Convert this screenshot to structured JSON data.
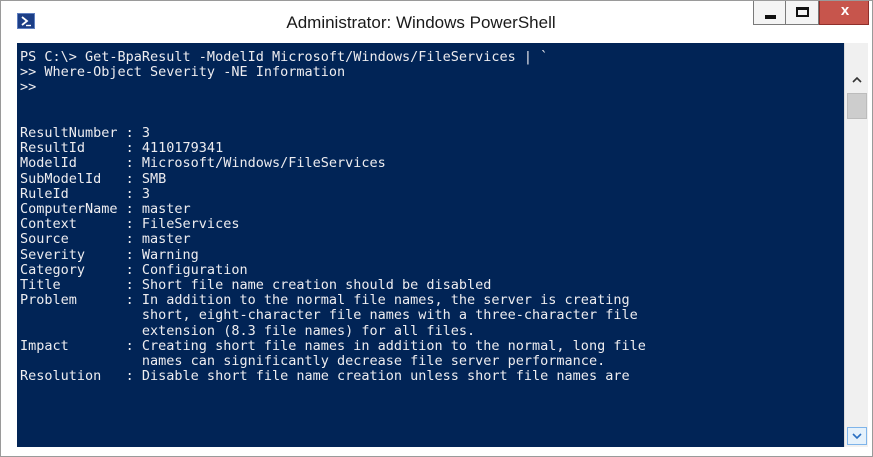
{
  "window": {
    "title": "Administrator: Windows PowerShell",
    "icon": "powershell-icon",
    "controls": {
      "minimize_icon": "minimize-icon",
      "maximize_icon": "maximize-icon",
      "close_label": "x"
    }
  },
  "console": {
    "background": "#012456",
    "foreground": "#eeedf0",
    "lines": [
      "PS C:\\> Get-BpaResult -ModelId Microsoft/Windows/FileServices | `",
      ">> Where-Object Severity -NE Information",
      ">>",
      "",
      "",
      "ResultNumber : 3",
      "ResultId     : 4110179341",
      "ModelId      : Microsoft/Windows/FileServices",
      "SubModelId   : SMB",
      "RuleId       : 3",
      "ComputerName : master",
      "Context      : FileServices",
      "Source       : master",
      "Severity     : Warning",
      "Category     : Configuration",
      "Title        : Short file name creation should be disabled",
      "Problem      : In addition to the normal file names, the server is creating",
      "               short, eight-character file names with a three-character file",
      "               extension (8.3 file names) for all files.",
      "Impact       : Creating short file names in addition to the normal, long file",
      "               names can significantly decrease file server performance.",
      "Resolution   : Disable short file name creation unless short file names are"
    ]
  },
  "scrollbar": {
    "up_icon": "scroll-up-arrow-icon",
    "down_icon": "scroll-down-arrow-icon"
  }
}
